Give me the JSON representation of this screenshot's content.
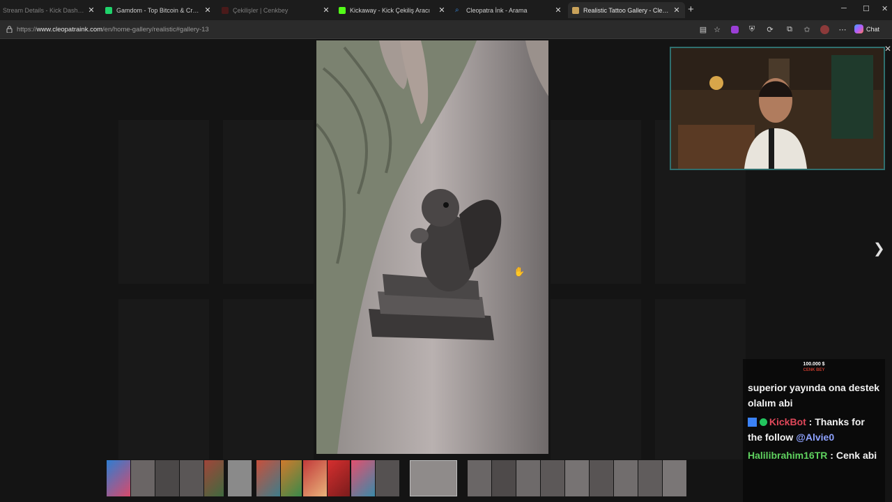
{
  "tabs": [
    {
      "title": "Stream Details - Kick Dashboard",
      "favicon": "kick-icon",
      "color": "#53fc18"
    },
    {
      "title": "Gamdom - Top Bitcoin & Crypto C",
      "favicon": "gamdom-icon",
      "color": "#1fd36b"
    },
    {
      "title": "Çekilişler | Cenkbey",
      "favicon": "cenkbey-icon",
      "color": "#8a2a2a"
    },
    {
      "title": "Kickaway - Kick Çekiliş Aracı",
      "favicon": "kickaway-icon",
      "color": "#53fc18"
    },
    {
      "title": "Cleopatra İnk - Arama",
      "favicon": "search-icon",
      "color": "#3a8ee6"
    },
    {
      "title": "Realistic Tattoo Gallery - Cleopatr",
      "favicon": "cleopatra-icon",
      "color": "#c9a25a"
    }
  ],
  "address": {
    "prefix": "https://",
    "domain": "www.cleopatraink.com",
    "path": "/en/home-gallery/realistic#gallery-13"
  },
  "toolbar": {
    "chat_label": "Chat"
  },
  "overlay": {
    "sub_goal_amount": "100.000 $",
    "sub_goal_name": "CENK BEY"
  },
  "chat": [
    {
      "user": "",
      "user_color": "#f2f2f2",
      "text": "superior yayında ona destek olalım abi"
    },
    {
      "user": "KickBot",
      "user_color": "#e0485a",
      "text": "Thanks for the follow",
      "mention": "@Alvie0"
    },
    {
      "user": "Halilibrahim16TR",
      "user_color": "#5fd15f",
      "text": "Cenk abi"
    }
  ],
  "gallery": {
    "main_image": "realistic-squirrel-tattoo",
    "thumbnail_count": 24
  }
}
